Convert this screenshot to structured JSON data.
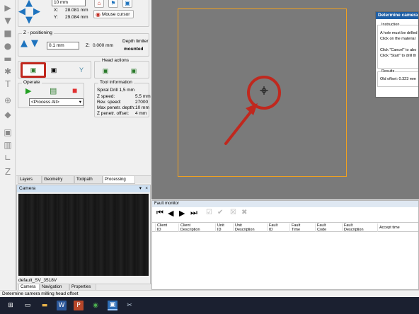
{
  "left_panel": {
    "xy_step": "10 mm",
    "x_label": "X:",
    "x_value": "28.081 mm",
    "y_label": "Y:",
    "y_value": "29.084 mm",
    "mouse_cursor_label": "Mouse cursor",
    "z_group_title": "Z - positioning",
    "z_step": "0.1 mm",
    "z_label": "Z:",
    "z_value": "0.000 mm",
    "depth_limiter_label": "Depth limiter",
    "depth_limiter_value": "mounted",
    "head_actions_label": "Head actions",
    "operate_label": "Operate",
    "process_select": "<Process All>",
    "tool_info_label": "Tool information",
    "tool_name": "Spiral Drill  1,5 mm",
    "tool_fields": [
      {
        "label": "Z speed:",
        "value": "5.5 mm"
      },
      {
        "label": "Rev. speed:",
        "value": "27000"
      },
      {
        "label": "Max penetr. depth:",
        "value": "10 mm"
      },
      {
        "label": "Z penetr. offset:",
        "value": "4 mm"
      }
    ]
  },
  "tabs": [
    "Layers",
    "Geometry",
    "Toolpath",
    "Processing"
  ],
  "camera_panel": {
    "title": "Camera",
    "camera_name": "default_SV_3518V",
    "bottom_tabs": [
      "Camera",
      "Navigation",
      "Properties"
    ]
  },
  "dialog": {
    "title": "Determine camera",
    "instruction_label": "Instruction",
    "instruction_lines": [
      "A hole must be drilled",
      "Click on the material",
      "",
      "Click \"Cancel\" to abo",
      "Click \"Start\" to drill th"
    ],
    "results_label": "Results",
    "old_offset": "Old offset: 0.323 mm"
  },
  "fault_monitor": {
    "title": "Fault monitor",
    "columns": [
      [
        "Client",
        "ID"
      ],
      [
        "Client",
        "Description"
      ],
      [
        "Unit",
        "ID"
      ],
      [
        "Unit",
        "Description"
      ],
      [
        "Fault",
        "ID"
      ],
      [
        "Fault",
        "Time"
      ],
      [
        "Fault",
        "Code"
      ],
      [
        "Fault",
        "Description"
      ],
      [
        "Accept time",
        ""
      ]
    ]
  },
  "status_text": "Determine camera milling head offset",
  "colors": {
    "canvas": "#7a7a7a",
    "frame": "#f0a020",
    "highlight": "#c0281e",
    "dialog_title": "#1f5fa5",
    "taskbar": "#1b2030"
  }
}
